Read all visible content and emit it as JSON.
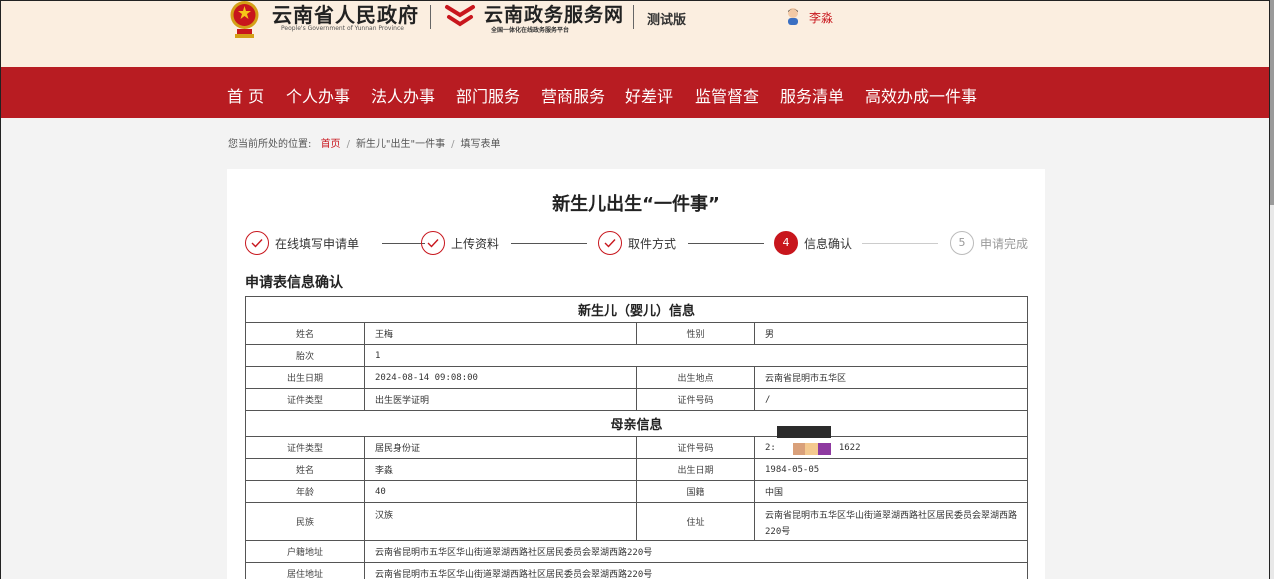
{
  "header": {
    "gov_title": "云南省人民政府",
    "gov_subtitle": "People's Government of Yunnan Province",
    "service_title": "云南政务服务网",
    "service_subtitle": "全国一体化在线政务服务平台",
    "test_label": "测试版",
    "user_name": "李淼"
  },
  "nav": {
    "items": [
      "首 页",
      "个人办事",
      "法人办事",
      "部门服务",
      "营商服务",
      "好差评",
      "监管督查",
      "服务清单",
      "高效办成一件事"
    ]
  },
  "breadcrumb": {
    "prefix": "您当前所处的位置:",
    "home": "首页",
    "item1": "新生儿\"出生\"一件事",
    "item2": "填写表单",
    "separator": "/"
  },
  "page": {
    "title": "新生儿出生“一件事”",
    "section_title": "申请表信息确认"
  },
  "steps": [
    {
      "label": "在线填写申请单",
      "status": "done"
    },
    {
      "label": "上传资料",
      "status": "done"
    },
    {
      "label": "取件方式",
      "status": "done"
    },
    {
      "label": "信息确认",
      "number": "4",
      "status": "active"
    },
    {
      "label": "申请完成",
      "number": "5",
      "status": "pending"
    }
  ],
  "table": {
    "baby_header": "新生儿（婴儿）信息",
    "baby": {
      "name_label": "姓名",
      "name": "王梅",
      "gender_label": "性别",
      "gender": "男",
      "birth_order_label": "胎次",
      "birth_order": "1",
      "birth_date_label": "出生日期",
      "birth_date": "2024-08-14 09:08:00",
      "birth_place_label": "出生地点",
      "birth_place": "云南省昆明市五华区",
      "cert_type_label": "证件类型",
      "cert_type": "出生医学证明",
      "cert_no_label": "证件号码",
      "cert_no": "/"
    },
    "mother_header": "母亲信息",
    "mother": {
      "cert_type_label": "证件类型",
      "cert_type": "居民身份证",
      "cert_no_label": "证件号码",
      "cert_no_prefix": "2:",
      "cert_no_suffix": "1622",
      "name_label": "姓名",
      "name": "李淼",
      "birth_date_label": "出生日期",
      "birth_date": "1984-05-05",
      "age_label": "年龄",
      "age": "40",
      "nationality_label": "国籍",
      "nationality": "中国",
      "ethnicity_label": "民族",
      "ethnicity": "汉族",
      "address_label": "住址",
      "address": "云南省昆明市五华区华山街道翠湖西路社区居民委员会翠湖西路220号",
      "household_label": "户籍地址",
      "household": "云南省昆明市五华区华山街道翠湖西路社区居民委员会翠湖西路220号",
      "residence_label": "居住地址",
      "residence": "云南省昆明市五华区华山街道翠湖西路社区居民委员会翠湖西路220号"
    }
  },
  "colors": {
    "brand_red": "#b81c22",
    "header_bg": "#fbeee0",
    "accent": "#c8161d"
  }
}
